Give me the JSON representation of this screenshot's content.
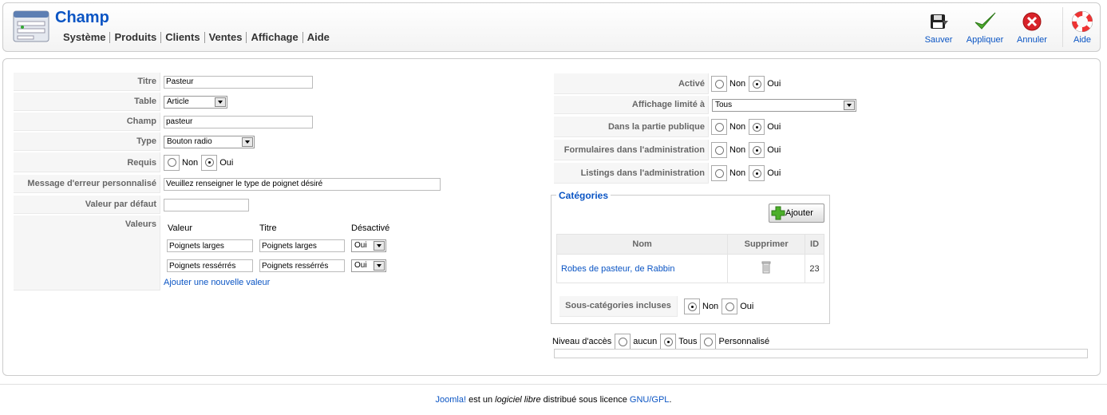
{
  "header": {
    "title": "Champ",
    "menu": [
      "Système",
      "Produits",
      "Clients",
      "Ventes",
      "Affichage",
      "Aide"
    ],
    "toolbar": {
      "save": "Sauver",
      "apply": "Appliquer",
      "cancel": "Annuler",
      "help": "Aide"
    }
  },
  "left_form": {
    "titre": {
      "label": "Titre",
      "value": "Pasteur"
    },
    "table": {
      "label": "Table",
      "value": "Article"
    },
    "champ": {
      "label": "Champ",
      "value": "pasteur"
    },
    "type": {
      "label": "Type",
      "value": "Bouton radio"
    },
    "requis": {
      "label": "Requis",
      "opt_no": "Non",
      "opt_yes": "Oui",
      "selected": "Oui"
    },
    "message": {
      "label": "Message d'erreur personnalisé",
      "value": "Veuillez renseigner le type de poignet désiré"
    },
    "defaut": {
      "label": "Valeur par défaut",
      "value": ""
    },
    "valeurs": {
      "label": "Valeurs",
      "headers": {
        "valeur": "Valeur",
        "titre": "Titre",
        "desactive": "Désactivé"
      },
      "rows": [
        {
          "valeur": "Poignets larges",
          "titre": "Poignets larges",
          "desactive": "Oui"
        },
        {
          "valeur": "Poignets ressérrés",
          "titre": "Poignets ressérrés",
          "desactive": "Oui"
        }
      ],
      "add_link": "Ajouter une nouvelle valeur"
    }
  },
  "right_form": {
    "active": {
      "label": "Activé",
      "opt_no": "Non",
      "opt_yes": "Oui",
      "selected": "Oui"
    },
    "affichage": {
      "label": "Affichage limité à",
      "value": "Tous"
    },
    "public": {
      "label": "Dans la partie publique",
      "opt_no": "Non",
      "opt_yes": "Oui",
      "selected": "Oui"
    },
    "formulaires": {
      "label": "Formulaires dans l'administration",
      "opt_no": "Non",
      "opt_yes": "Oui",
      "selected": "Oui"
    },
    "listings": {
      "label": "Listings dans l'administration",
      "opt_no": "Non",
      "opt_yes": "Oui",
      "selected": "Oui"
    }
  },
  "categories": {
    "legend": "Catégories",
    "add_button": "Ajouter",
    "columns": {
      "nom": "Nom",
      "supprimer": "Supprimer",
      "id": "ID"
    },
    "rows": [
      {
        "nom": "Robes de pasteur, de Rabbin",
        "id": "23"
      }
    ],
    "sub": {
      "label": "Sous-catégories incluses",
      "opt_no": "Non",
      "opt_yes": "Oui",
      "selected": "Non"
    }
  },
  "access": {
    "label": "Niveau d'accès",
    "opt_none": "aucun",
    "opt_all": "Tous",
    "opt_custom": "Personnalisé",
    "selected": "Tous"
  },
  "footer": {
    "joomla": "Joomla!",
    "text1": " est un ",
    "libre": "logiciel libre",
    "text2": " distribué sous licence ",
    "gpl": "GNU/GPL",
    "end": "."
  }
}
